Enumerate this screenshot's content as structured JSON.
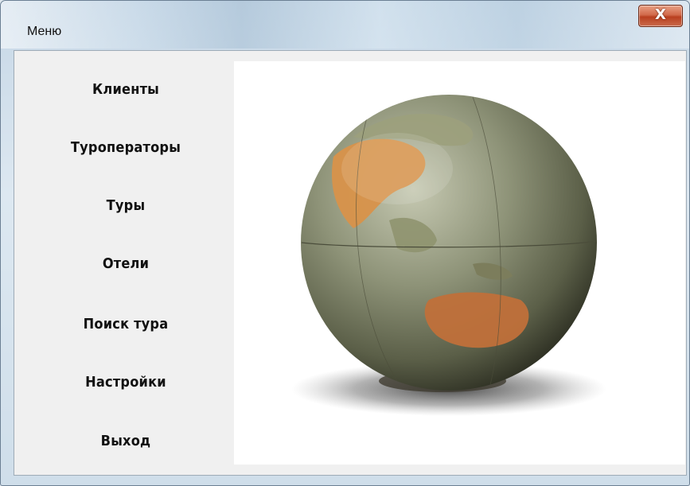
{
  "window": {
    "title": "Меню"
  },
  "titlebar": {
    "close_glyph": "X",
    "close_icon": "close-icon"
  },
  "menu": {
    "items": [
      {
        "label": "Клиенты"
      },
      {
        "label": "Туроператоры"
      },
      {
        "label": "Туры"
      },
      {
        "label": "Отели"
      },
      {
        "label": "Поиск тура"
      },
      {
        "label": "Настройки"
      },
      {
        "label": "Выход"
      }
    ]
  },
  "picture": {
    "subject": "globe-image"
  },
  "colors": {
    "close_button": "#c9552f",
    "client_bg": "#f0f0f0",
    "picture_bg": "#ffffff"
  }
}
